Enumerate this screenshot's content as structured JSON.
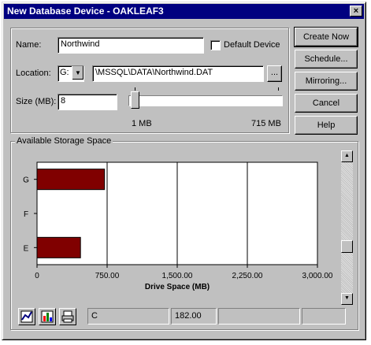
{
  "window": {
    "title": "New Database Device - OAKLEAF3",
    "close_glyph": "×"
  },
  "form": {
    "name_label": "Name:",
    "name_value": "Northwind",
    "default_device_label": "Default Device",
    "default_device_checked": false,
    "location_label": "Location:",
    "drive_value": "G:",
    "path_value": "\\MSSQL\\DATA\\Northwind.DAT",
    "browse_label": "...",
    "size_label": "Size (MB):",
    "size_value": "8",
    "slider_min_label": "1 MB",
    "slider_max_label": "715 MB"
  },
  "buttons": {
    "create_now": "Create Now",
    "schedule": "Schedule...",
    "mirroring": "Mirroring...",
    "cancel": "Cancel",
    "help": "Help"
  },
  "storage": {
    "group_label": "Available Storage Space"
  },
  "chart_data": {
    "type": "bar",
    "orientation": "horizontal",
    "categories": [
      "G",
      "F",
      "E"
    ],
    "values": [
      722,
      0,
      465
    ],
    "xlabel": "Drive Space (MB)",
    "xlim": [
      0,
      3000
    ],
    "xticks": [
      "0",
      "750.00",
      "1,500.00",
      "2,250.00",
      "3,000.00"
    ],
    "bar_color": "#800000",
    "grid": true
  },
  "status": {
    "drive_cell": "C",
    "value_cell": "182.00",
    "cell3": "",
    "cell4": ""
  },
  "toolbar": {
    "icons": [
      "chart-type-icon",
      "bar-chart-icon",
      "print-icon"
    ]
  },
  "colors": {
    "titlebar": "#000080",
    "face": "#c0c0c0",
    "bar": "#800000"
  }
}
